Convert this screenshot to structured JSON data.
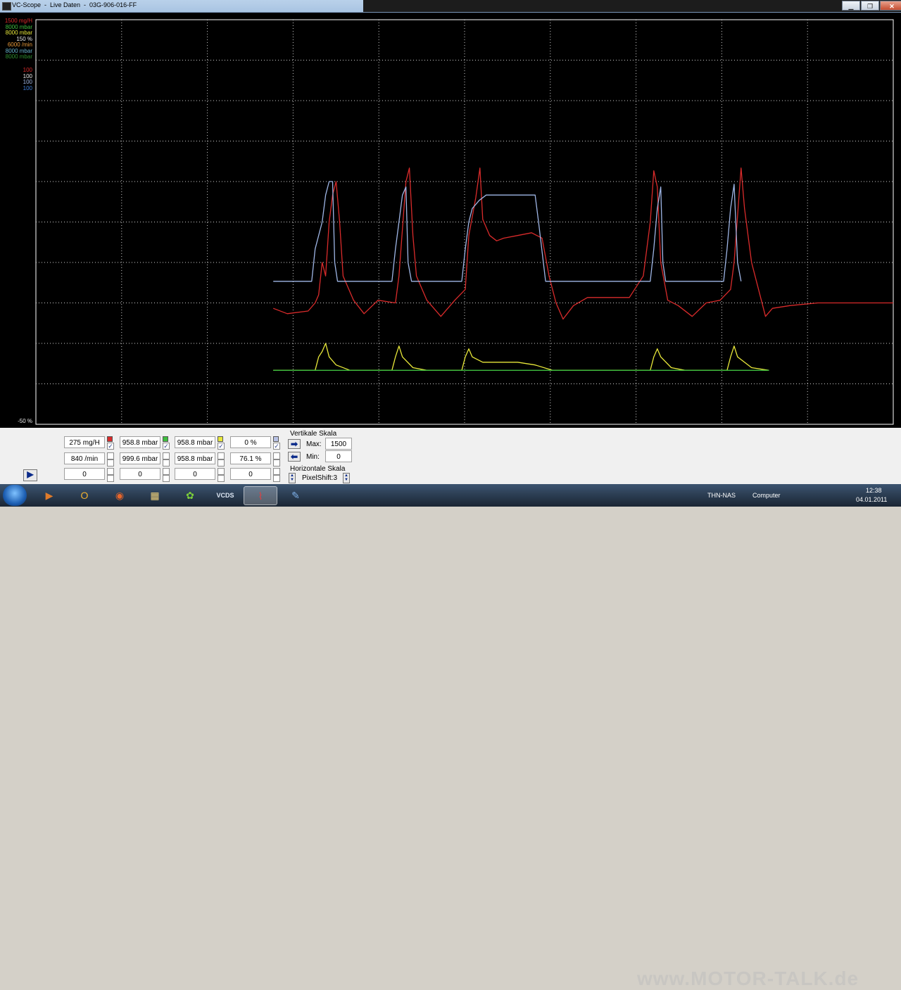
{
  "window": {
    "title": "VC-Scope  -  Live Daten  -  03G-906-016-FF",
    "minimize_glyph": "▁",
    "maximize_glyph": "❐",
    "close_glyph": "✕"
  },
  "scale_labels": [
    {
      "text": "1500 mg/H",
      "color": "#d92b2b"
    },
    {
      "text": "8000 mbar",
      "color": "#3fbf3f"
    },
    {
      "text": "8000 mbar",
      "color": "#e8e83a"
    },
    {
      "text": "150 %",
      "color": "#e8e8e8"
    },
    {
      "text": "6000 /min",
      "color": "#e89a3a"
    },
    {
      "text": "8000 mbar",
      "color": "#66b2cc"
    },
    {
      "text": "8000 mbar",
      "color": "#2f8f2f"
    },
    {
      "text": "100",
      "color": "#d92b2b"
    },
    {
      "text": "100",
      "color": "#e8e8e8"
    },
    {
      "text": "100",
      "color": "#9fb6e6"
    },
    {
      "text": "100",
      "color": "#3f7fd9"
    }
  ],
  "scope_bottom_label": "-50 %",
  "chart_data": {
    "type": "line",
    "x_unit": "samples",
    "y_unit": "% of scale",
    "xlim": [
      0,
      1228
    ],
    "ylim": [
      -50,
      100
    ],
    "grid": true,
    "series": [
      {
        "name": "1500 mg/H",
        "color": "#d92b2b",
        "points": [
          [
            340,
            -7
          ],
          [
            360,
            -9
          ],
          [
            390,
            -8
          ],
          [
            400,
            -5
          ],
          [
            405,
            -2
          ],
          [
            410,
            10
          ],
          [
            415,
            5
          ],
          [
            420,
            25
          ],
          [
            425,
            35
          ],
          [
            430,
            40
          ],
          [
            435,
            25
          ],
          [
            440,
            5
          ],
          [
            455,
            -4
          ],
          [
            470,
            -9
          ],
          [
            490,
            -4
          ],
          [
            515,
            -5
          ],
          [
            520,
            5
          ],
          [
            530,
            40
          ],
          [
            535,
            45
          ],
          [
            540,
            20
          ],
          [
            545,
            5
          ],
          [
            560,
            -4
          ],
          [
            580,
            -10
          ],
          [
            600,
            -4
          ],
          [
            615,
            0
          ],
          [
            620,
            20
          ],
          [
            630,
            34
          ],
          [
            636,
            45
          ],
          [
            640,
            26
          ],
          [
            650,
            20
          ],
          [
            660,
            18
          ],
          [
            670,
            19
          ],
          [
            690,
            20
          ],
          [
            710,
            21
          ],
          [
            725,
            19
          ],
          [
            735,
            5
          ],
          [
            745,
            -5
          ],
          [
            755,
            -11
          ],
          [
            770,
            -6
          ],
          [
            790,
            -3
          ],
          [
            825,
            -3
          ],
          [
            850,
            -3
          ],
          [
            870,
            5
          ],
          [
            880,
            25
          ],
          [
            885,
            44
          ],
          [
            890,
            38
          ],
          [
            895,
            10
          ],
          [
            905,
            -4
          ],
          [
            920,
            -6
          ],
          [
            940,
            -10
          ],
          [
            960,
            -5
          ],
          [
            980,
            -4
          ],
          [
            995,
            0
          ],
          [
            1000,
            10
          ],
          [
            1010,
            45
          ],
          [
            1015,
            30
          ],
          [
            1025,
            10
          ],
          [
            1035,
            0
          ],
          [
            1045,
            -10
          ],
          [
            1055,
            -7
          ],
          [
            1080,
            -6
          ],
          [
            1120,
            -5
          ],
          [
            1160,
            -5
          ],
          [
            1228,
            -5
          ]
        ]
      },
      {
        "name": "8000 mbar",
        "color": "#9fb6e6",
        "points": [
          [
            340,
            3
          ],
          [
            395,
            3
          ],
          [
            400,
            15
          ],
          [
            410,
            25
          ],
          [
            415,
            35
          ],
          [
            420,
            40
          ],
          [
            425,
            40
          ],
          [
            428,
            10
          ],
          [
            432,
            3
          ],
          [
            510,
            3
          ],
          [
            515,
            15
          ],
          [
            520,
            25
          ],
          [
            525,
            35
          ],
          [
            530,
            38
          ],
          [
            533,
            10
          ],
          [
            538,
            3
          ],
          [
            610,
            3
          ],
          [
            615,
            15
          ],
          [
            620,
            25
          ],
          [
            625,
            30
          ],
          [
            635,
            33
          ],
          [
            645,
            35
          ],
          [
            660,
            35
          ],
          [
            670,
            35
          ],
          [
            690,
            35
          ],
          [
            715,
            35
          ],
          [
            720,
            25
          ],
          [
            730,
            3
          ],
          [
            880,
            3
          ],
          [
            885,
            15
          ],
          [
            890,
            30
          ],
          [
            895,
            38
          ],
          [
            898,
            10
          ],
          [
            902,
            3
          ],
          [
            985,
            3
          ],
          [
            990,
            15
          ],
          [
            995,
            30
          ],
          [
            1000,
            39
          ],
          [
            1005,
            10
          ],
          [
            1010,
            3
          ]
        ]
      },
      {
        "name": "8000 mbar",
        "color": "#e8e83a",
        "points": [
          [
            340,
            -30
          ],
          [
            400,
            -30
          ],
          [
            405,
            -25
          ],
          [
            410,
            -23
          ],
          [
            415,
            -20
          ],
          [
            420,
            -25
          ],
          [
            430,
            -28
          ],
          [
            450,
            -30
          ],
          [
            510,
            -30
          ],
          [
            515,
            -25
          ],
          [
            520,
            -21
          ],
          [
            525,
            -25
          ],
          [
            540,
            -29
          ],
          [
            560,
            -30
          ],
          [
            610,
            -30
          ],
          [
            615,
            -25
          ],
          [
            620,
            -22
          ],
          [
            625,
            -25
          ],
          [
            640,
            -27
          ],
          [
            660,
            -27
          ],
          [
            690,
            -27
          ],
          [
            715,
            -28
          ],
          [
            740,
            -30
          ],
          [
            880,
            -30
          ],
          [
            885,
            -25
          ],
          [
            890,
            -22
          ],
          [
            895,
            -25
          ],
          [
            910,
            -29
          ],
          [
            930,
            -30
          ],
          [
            990,
            -30
          ],
          [
            995,
            -25
          ],
          [
            1000,
            -21
          ],
          [
            1005,
            -25
          ],
          [
            1025,
            -29
          ],
          [
            1050,
            -30
          ]
        ]
      },
      {
        "name": "8000 mbar",
        "color": "#3fbf3f",
        "points": [
          [
            340,
            -30
          ],
          [
            1050,
            -30
          ]
        ]
      }
    ]
  },
  "panel": {
    "readouts": [
      [
        "275 mg/H",
        "958.8 mbar",
        "958.8 mbar",
        "0 %"
      ],
      [
        "840 /min",
        "999.6 mbar",
        "958.8 mbar",
        "76.1 %"
      ],
      [
        "0",
        "0",
        "0",
        "0"
      ]
    ],
    "swatch_colors": [
      "#d92b2b",
      "#3fbf3f",
      "#e8e83a",
      "#b9c3e6"
    ],
    "checks": [
      [
        true,
        true,
        true,
        true
      ],
      [
        false,
        false,
        false,
        false
      ],
      [
        false,
        false,
        false,
        false
      ]
    ],
    "vertical_scale": {
      "title": "Vertikale Skala",
      "max_label": "Max:",
      "max_value": "1500",
      "min_label": "Min:",
      "min_value": "0"
    },
    "horizontal_scale": {
      "title": "Horizontale Skala",
      "pixelshift": "PixelShift:3"
    },
    "arrow_right": "➡",
    "arrow_left": "⬅",
    "play_glyph": "▶",
    "spin_up": "▲",
    "spin_down": "▼"
  },
  "taskbar": {
    "items": [
      {
        "name": "media-player-icon",
        "glyph": "▶",
        "color": "#e07b2a"
      },
      {
        "name": "outlook-icon",
        "glyph": "O",
        "color": "#f0b030"
      },
      {
        "name": "firefox-icon",
        "glyph": "◉",
        "color": "#e8652a"
      },
      {
        "name": "explorer-icon",
        "glyph": "▦",
        "color": "#f2d27a"
      },
      {
        "name": "icq-icon",
        "glyph": "✿",
        "color": "#7ccf3a"
      },
      {
        "name": "vcds-icon",
        "glyph": "VCDS",
        "color": "#dfe8f5"
      },
      {
        "name": "vc-scope-icon",
        "glyph": "⌇",
        "color": "#e04040"
      },
      {
        "name": "paint-icon",
        "glyph": "✎",
        "color": "#7fb0e8"
      }
    ],
    "tray_host": "THN-NAS",
    "tray_computer": "Computer",
    "clock_time": "12:38",
    "clock_date": "04.01.2011",
    "watermark": "www.MOTOR-TALK.de"
  }
}
